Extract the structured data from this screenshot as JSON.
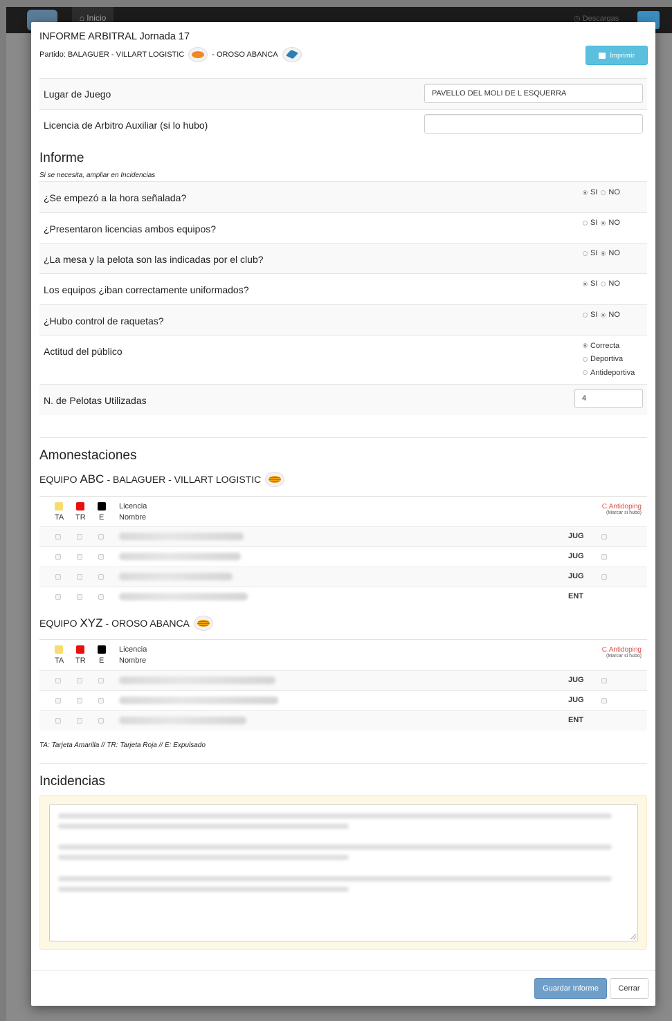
{
  "topbar": {
    "home_label": "Inicio",
    "downloads_label": "Descargas"
  },
  "header": {
    "title": "INFORME ARBITRAL Jornada 17",
    "match_prefix": "Partido: BALAGUER - VILLART LOGISTIC",
    "match_sep": "- OROSO ABANCA",
    "print_label": "Imprimir"
  },
  "fields": {
    "lugar_label": "Lugar de Juego",
    "lugar_value": "PAVELLO DEL MOLI DE L ESQUERRA",
    "licencia_aux_label": "Licencia de Arbitro Auxiliar (si lo hubo)",
    "licencia_aux_value": ""
  },
  "informe": {
    "title": "Informe",
    "hint": "Si se necesita, ampliar en Incidencias",
    "yes_label": "SI",
    "no_label": "NO",
    "questions": [
      {
        "label": "¿Se empezó a la hora señalada?",
        "answer": "SI"
      },
      {
        "label": "¿Presentaron licencias ambos equipos?",
        "answer": "NO"
      },
      {
        "label": "¿La mesa y la pelota son las indicadas por el club?",
        "answer": "NO"
      },
      {
        "label": "Los equipos ¿iban correctamente uniformados?",
        "answer": "SI"
      },
      {
        "label": "¿Hubo control de raquetas?",
        "answer": "NO"
      }
    ],
    "actitud_label": "Actitud del público",
    "actitud_options": [
      "Correcta",
      "Deportiva",
      "Antideportiva"
    ],
    "actitud_selected": "Correcta",
    "pelotas_label": "N. de Pelotas Utilizadas",
    "pelotas_value": "4"
  },
  "amonestaciones": {
    "title": "Amonestaciones",
    "col_ta": "TA",
    "col_tr": "TR",
    "col_e": "E",
    "col_licencia": "Licencia",
    "col_nombre": "Nombre",
    "antidoping_label": "C.Antidoping",
    "antidoping_hint": "(Marcar si hubo)",
    "colors": {
      "yellow": "#f7dc6f",
      "red": "#e8100f",
      "black": "#000000"
    },
    "teams": [
      {
        "prefix": "EQUIPO",
        "code": "ABC",
        "name": "- BALAGUER - VILLART LOGISTIC",
        "rows": [
          {
            "role": "JUG"
          },
          {
            "role": "JUG"
          },
          {
            "role": "JUG"
          },
          {
            "role": "ENT"
          }
        ]
      },
      {
        "prefix": "EQUIPO",
        "code": "XYZ",
        "name": "- OROSO ABANCA",
        "rows": [
          {
            "role": "JUG"
          },
          {
            "role": "JUG"
          },
          {
            "role": "ENT"
          }
        ]
      }
    ],
    "legend": "TA: Tarjeta Amarilla // TR: Tarjeta Roja // E: Expulsado"
  },
  "incidencias": {
    "title": "Incidencias"
  },
  "footer": {
    "save_label": "Guardar Informe",
    "close_label": "Cerrar"
  }
}
